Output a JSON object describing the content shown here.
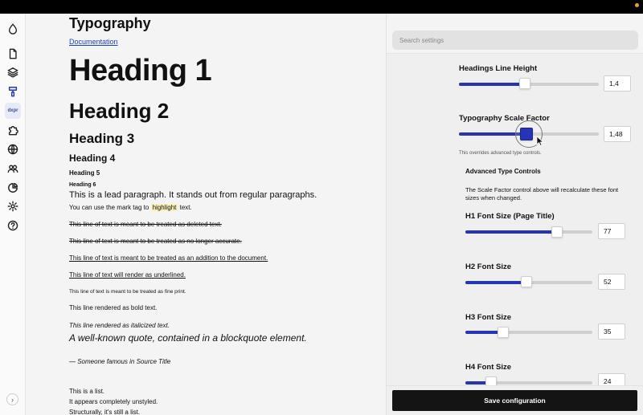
{
  "preview": {
    "title": "Typography",
    "doc_link": "Documentation",
    "h1": "Heading 1",
    "h2": "Heading 2",
    "h3": "Heading 3",
    "h4": "Heading 4",
    "h5": "Heading 5",
    "h6": "Heading 6",
    "lead": "This is a lead paragraph. It stands out from regular paragraphs.",
    "mark_before": "You can use the mark tag to",
    "mark_word": "highlight",
    "mark_after": "text.",
    "deleted": "This line of text is meant to be treated as deleted text.",
    "no_longer": "This line of text is meant to be treated as no longer accurate.",
    "addition": "This line of text is meant to be treated as an addition to the document.",
    "underlined": "This line of text will render as underlined.",
    "fine_print": "This line of text is meant to be treated as fine print.",
    "bold": "This line rendered as bold text.",
    "italic": "This line rendered as italicized text.",
    "quote": "A well-known quote, contained in a blockquote element.",
    "cite": "— Someone famous in Source Title",
    "list": [
      "This is a list.",
      "It appears completely unstyled.",
      "Structurally, it's still a list."
    ]
  },
  "rail": {
    "items": [
      "drop-icon",
      "file-icon",
      "layers-icon",
      "paint-icon",
      "dxpr-badge",
      "puzzle-icon",
      "globe-icon",
      "users-icon",
      "chart-icon",
      "gear-icon",
      "help-icon"
    ],
    "badge_text": "dxpr",
    "expand": "›"
  },
  "settings": {
    "search_placeholder": "Search settings",
    "headings_line_height": {
      "label": "Headings Line Height",
      "value": "1,4",
      "level": 0.47
    },
    "scale_factor": {
      "label": "Typography Scale Factor",
      "value": "1,48",
      "level": 0.48,
      "hint": "This overrides advanced type controls."
    },
    "advanced": {
      "title": "Advanced Type Controls",
      "desc": "The Scale Factor control above will recalculate these font sizes when changed."
    },
    "h1_size": {
      "label": "H1 Font Size (Page Title)",
      "value": "77",
      "level": 0.72
    },
    "h2_size": {
      "label": "H2 Font Size",
      "value": "52",
      "level": 0.48
    },
    "h3_size": {
      "label": "H3 Font Size",
      "value": "35",
      "level": 0.3
    },
    "h4_size": {
      "label": "H4 Font Size",
      "value": "24",
      "level": 0.2
    },
    "save_label": "Save configuration"
  },
  "colors": {
    "accent": "#2635b5",
    "save_bg": "#141414",
    "highlight": "#fbf0b6",
    "link": "#1a3fcf"
  }
}
